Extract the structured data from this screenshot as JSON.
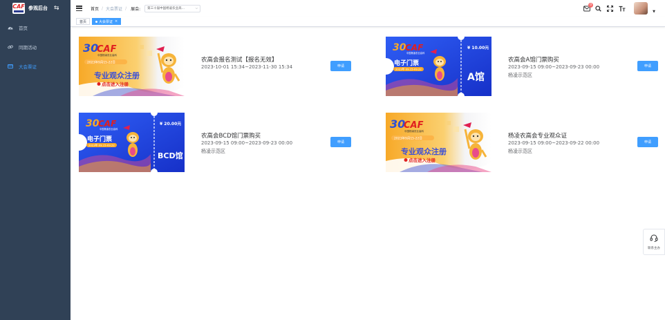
{
  "sidebar": {
    "logo_text": "CAF",
    "title": "参观后台",
    "collapse_icon": "switch-icon",
    "items": [
      {
        "label": "首页",
        "icon": "dashboard-icon",
        "active": false
      },
      {
        "label": "同期活动",
        "icon": "link-icon",
        "active": false
      },
      {
        "label": "大会票证",
        "icon": "ticket-icon",
        "active": true
      }
    ]
  },
  "header": {
    "breadcrumb": [
      "首页",
      "大会票证"
    ],
    "exhibition_label": "展会:",
    "exhibition_value": "第三十届中国杨凌农业高…",
    "mail_badge": "0",
    "icons": [
      "mail-icon",
      "search-icon",
      "fullscreen-icon",
      "font-size-icon"
    ]
  },
  "tags": [
    {
      "label": "首页",
      "active": false
    },
    {
      "label": "大会票证",
      "active": true
    }
  ],
  "colors": {
    "sidebar": "#304156",
    "accent": "#409eff",
    "ticket_blue": "#1a3fd6",
    "poster_orange": "#f7a928"
  },
  "cards": [
    {
      "name": "农高会报名测试【报名无效】",
      "time": "2023-10-01 15:34~2023-11-30 15:34",
      "location": "",
      "button": "申请",
      "thumb": {
        "style": "poster",
        "logo": "CAF",
        "logo_sub": "中国杨凌农业高科",
        "headline": "专业观众注册",
        "cta": "点击进入注册",
        "date_line": "2023年9月15-22日"
      }
    },
    {
      "name": "农高会A馆门票购买",
      "time": "2023-09-15 09:00~2023-09-23 00:00",
      "location": "杨凌示范区",
      "button": "申请",
      "thumb": {
        "style": "ticket",
        "logo": "CAF",
        "logo_sub": "中国杨凌农业高科",
        "headline": "电子门票",
        "price": "¥ 10.00元",
        "hall": "A馆",
        "date_line": "2023年 09.15-09.22"
      }
    },
    {
      "name": "农高会BCD馆门票购买",
      "time": "2023-09-15 09:00~2023-09-23 00:00",
      "location": "杨凌示范区",
      "button": "申请",
      "thumb": {
        "style": "ticket",
        "logo": "CAF",
        "logo_sub": "中国杨凌农业高科",
        "headline": "电子门票",
        "price": "¥ 20.00元",
        "hall": "BCD馆",
        "date_line": "2023年 09.15-09.22"
      }
    },
    {
      "name": "杨凌农高会专业观众证",
      "time": "2023-09-15 09:00~2023-09-22 00:00",
      "location": "杨凌示范区",
      "button": "申请",
      "thumb": {
        "style": "poster",
        "logo": "CAF",
        "logo_sub": "中国杨凌农业高科",
        "headline": "专业观众注册",
        "cta": "点击进入注册",
        "date_line": "2023年9月15-22日"
      }
    }
  ],
  "float_service": {
    "label": "联系主办",
    "icon": "headset-icon"
  }
}
